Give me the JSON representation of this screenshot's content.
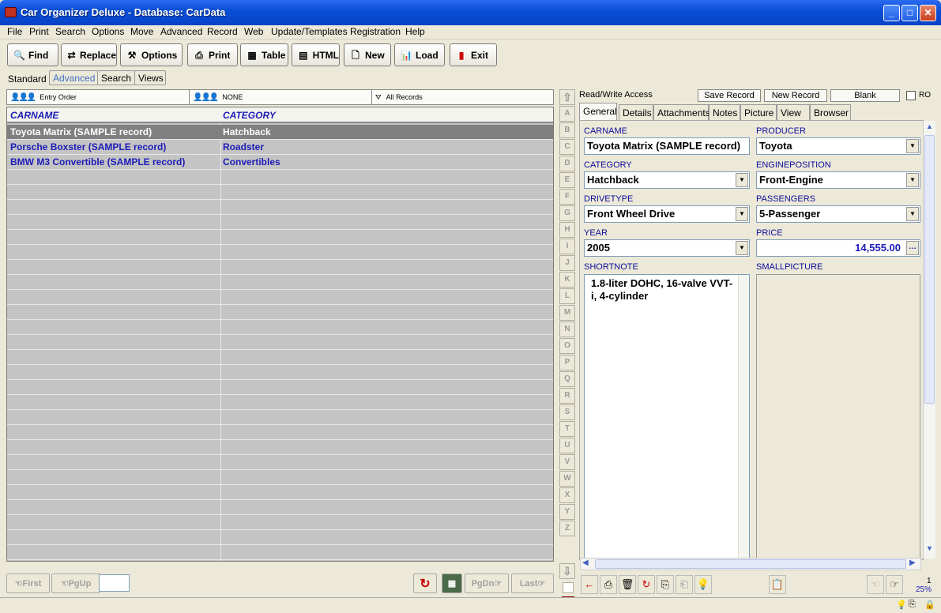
{
  "window": {
    "title": "Car Organizer Deluxe - Database: CarData"
  },
  "menu": [
    "File",
    "Print",
    "Search",
    "Options",
    "Move",
    "Advanced",
    "Record",
    "Web",
    "Update/Templates",
    "Registration",
    "Help"
  ],
  "toolbar": {
    "find": "Find",
    "replace": "Replace",
    "options": "Options",
    "print": "Print",
    "table": "Table",
    "html": "HTML",
    "new": "New",
    "load": "Load",
    "exit": "Exit"
  },
  "modetabs": {
    "standard": "Standard",
    "advanced": "Advanced",
    "search": "Search",
    "views": "Views"
  },
  "sortbar": {
    "order": "Entry Order",
    "filter": "NONE",
    "records": "All Records"
  },
  "grid": {
    "headers": [
      "CARNAME",
      "CATEGORY"
    ],
    "rows": [
      {
        "name": "Toyota Matrix (SAMPLE record)",
        "category": "Hatchback"
      },
      {
        "name": "Porsche Boxster (SAMPLE record)",
        "category": "Roadster"
      },
      {
        "name": "BMW M3 Convertible (SAMPLE record)",
        "category": "Convertibles"
      }
    ]
  },
  "gridnav": {
    "first": "First",
    "pgup": "PgUp",
    "pgdn": "PgDn",
    "last": "Last"
  },
  "alpha": [
    "A",
    "B",
    "C",
    "D",
    "E",
    "F",
    "G",
    "H",
    "I",
    "J",
    "K",
    "L",
    "M",
    "N",
    "O",
    "P",
    "Q",
    "R",
    "S",
    "T",
    "U",
    "V",
    "W",
    "X",
    "Y",
    "Z"
  ],
  "record": {
    "access": "Read/Write Access",
    "save": "Save Record",
    "new": "New Record",
    "blank": "Blank",
    "ro": "RO"
  },
  "tabs": [
    "General",
    "Details",
    "Attachments",
    "Notes",
    "Picture",
    "View",
    "Browser"
  ],
  "form": {
    "carname_lbl": "CARNAME",
    "carname": "Toyota Matrix (SAMPLE record)",
    "producer_lbl": "PRODUCER",
    "producer": "Toyota",
    "category_lbl": "CATEGORY",
    "category": "Hatchback",
    "engine_lbl": "ENGINEPOSITION",
    "engine": "Front-Engine",
    "drive_lbl": "DRIVETYPE",
    "drive": "Front Wheel Drive",
    "pass_lbl": "PASSENGERS",
    "pass": "5-Passenger",
    "year_lbl": "YEAR",
    "year": "2005",
    "price_lbl": "PRICE",
    "price": "14,555.00",
    "note_lbl": "SHORTNOTE",
    "note": "1.8-liter DOHC, 16-valve VVT-i, 4-cylinder",
    "pic_lbl": "SMALLPICTURE"
  },
  "counter": {
    "record": "1",
    "zoom": "25%"
  }
}
